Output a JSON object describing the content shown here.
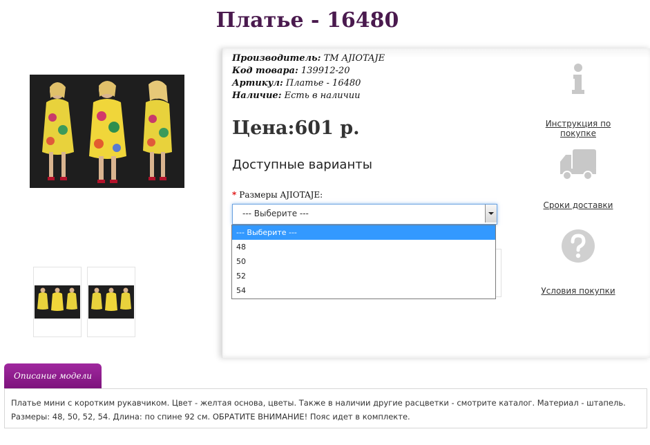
{
  "product": {
    "title": "Платье - 16480"
  },
  "specs": {
    "manufacturer_label": "Производитель:",
    "manufacturer_value": "ТМ AJIOTAJE",
    "code_label": "Код товара:",
    "code_value": "139912-20",
    "article_label": "Артикул:",
    "article_value": "Платье - 16480",
    "availability_label": "Наличие:",
    "availability_value": "Есть в наличии"
  },
  "price": "Цена:601 р.",
  "variants": {
    "title": "Доступные варианты",
    "required_mark": "*",
    "size_label": "Размеры AJIOTAJE:",
    "selected": "--- Выберите ---",
    "options": [
      "--- Выберите ---",
      "48",
      "50",
      "52",
      "54"
    ]
  },
  "side_links": {
    "instruction": "Инструкция по покупке",
    "delivery": "Сроки доставки",
    "conditions": "Условия покупки"
  },
  "icons": {
    "info": "info-icon",
    "truck": "truck-icon",
    "question": "question-icon"
  },
  "description": {
    "tab_label": "Описание модели",
    "text": "Платье мини с коротким рукавчиком. Цвет - желтая основа, цветы. Также в наличии другие расцветки - смотрите каталог. Материал - штапель. Размеры: 48, 50, 52, 54. Длина: по спине 92 см. ОБРАТИТЕ ВНИМАНИЕ! Пояс идет в комплекте."
  },
  "colors": {
    "title": "#4a1a4e",
    "tab": "#8e1f8d",
    "dropdown_selected": "#3399ff",
    "icon_gray": "#c8c8c8"
  }
}
